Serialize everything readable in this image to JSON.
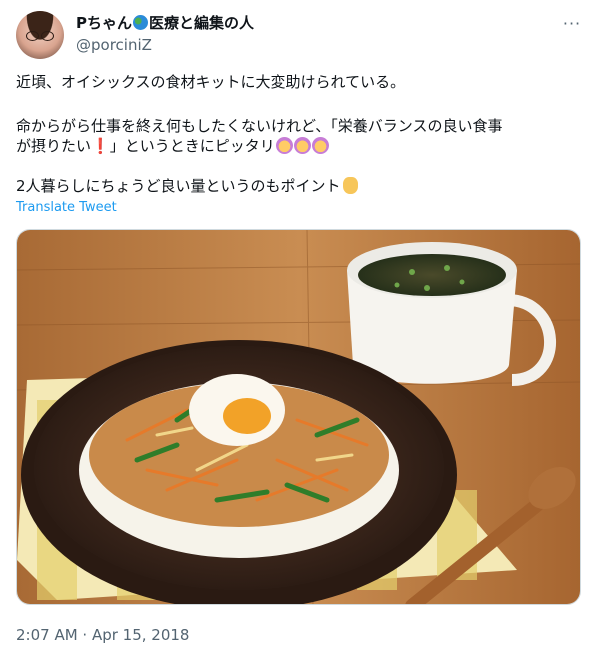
{
  "author": {
    "display_name_prefix": "Pちゃん",
    "display_name_suffix": "医療と編集の人",
    "handle": "@porciniZ"
  },
  "tweet": {
    "line1": "近頃、オイシックスの食材キットに大変助けられている。",
    "line2": "命からがら仕事を終え何もしたくないけれど、「栄養バランスの良い食事",
    "line3_a": "が摂りたい",
    "line3_bang": "❗",
    "line3_b": "」というときにピッタリ",
    "line4": "2人暮らしにちょうど良い量というのもポイント",
    "translate_label": "Translate Tweet"
  },
  "more_label": "···",
  "timestamp": "2:07 AM · Apr 15, 2018",
  "icons": {
    "globe": "globe-emoji",
    "face": "face-with-hands-emoji",
    "ok": "ok-hand-emoji"
  },
  "colors": {
    "link": "#1d9bf0",
    "secondary_text": "#536471",
    "border": "#cfd9de"
  }
}
